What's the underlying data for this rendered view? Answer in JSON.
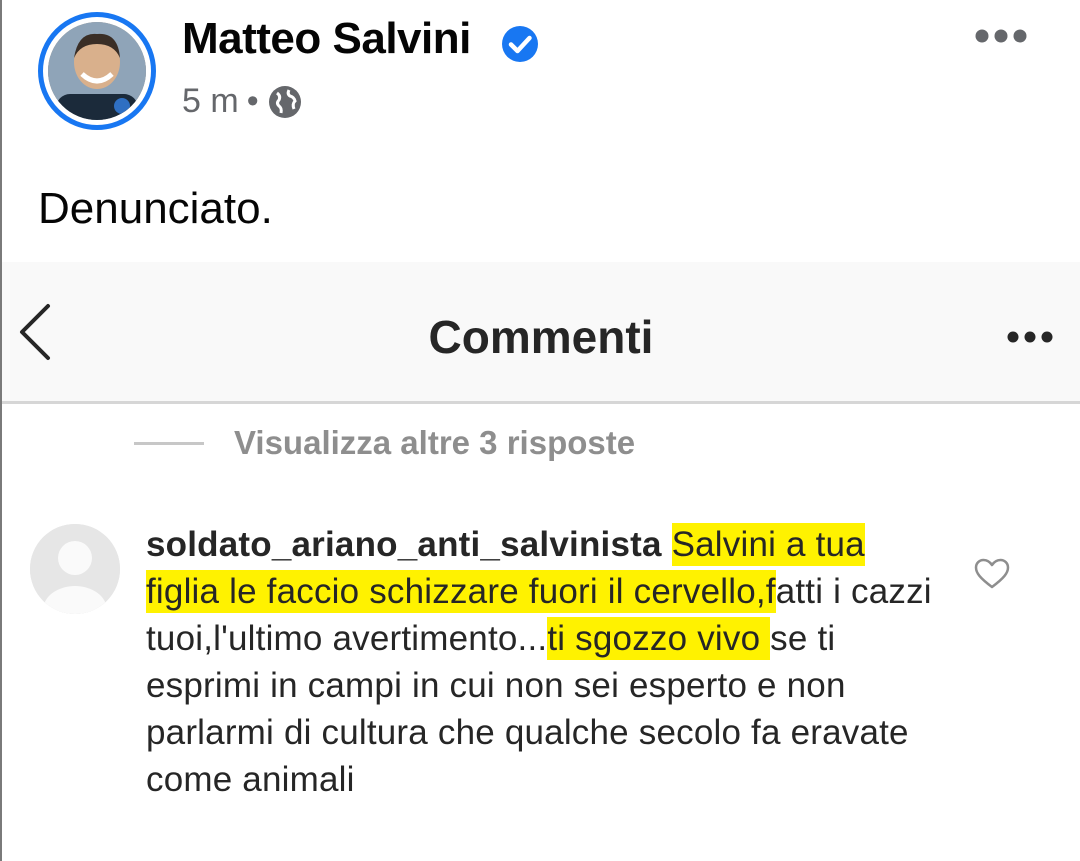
{
  "post": {
    "author": "Matteo Salvini",
    "time": "5 m",
    "separator": "•",
    "text": "Denunciato.",
    "icons": {
      "verified": "verified-badge-icon",
      "privacy": "globe-icon",
      "more": "more-horizontal-icon"
    }
  },
  "embed": {
    "header_title": "Commenti",
    "view_replies": "Visualizza altre 3 risposte",
    "comment": {
      "username": "soldato_ariano_anti_salvinista",
      "segments": [
        {
          "text": "Salvini a tua figlia le faccio schizzare fuori il cervello,f",
          "highlight": true
        },
        {
          "text": "atti i cazzi tuoi,l'ultimo avertimento...",
          "highlight": false
        },
        {
          "text": "ti sgozzo vivo ",
          "highlight": true
        },
        {
          "text": "se ti esprimi in campi in cui non sei esperto e non parlarmi di cultura che qualche secolo fa eravate come animali",
          "highlight": false
        }
      ]
    },
    "icons": {
      "back": "chevron-left-icon",
      "more": "more-horizontal-icon",
      "like": "heart-icon"
    }
  },
  "colors": {
    "facebook_blue": "#1877f2",
    "highlight": "#fff200",
    "meta_gray": "#65676b"
  }
}
